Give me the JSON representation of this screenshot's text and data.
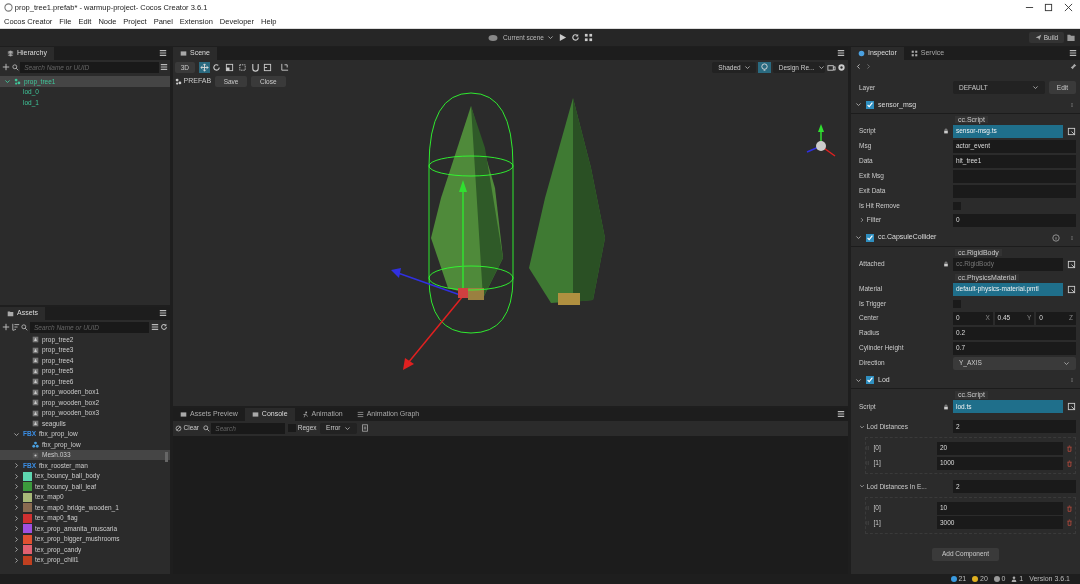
{
  "window": {
    "title": "prop_tree1.prefab* - warmup-project- Cocos Creator 3.6.1"
  },
  "menu": [
    "Cocos Creator",
    "File",
    "Edit",
    "Node",
    "Project",
    "Panel",
    "Extension",
    "Developer",
    "Help"
  ],
  "toolbar": {
    "scene_select": "Current scene",
    "build": "Build"
  },
  "hierarchy": {
    "title": "Hierarchy",
    "placeholder": "Search Name or UUID",
    "tree": [
      {
        "label": "prop_tree1",
        "kind": "prefab",
        "expanded": true,
        "selected": true,
        "children": [
          {
            "label": "lod_0",
            "selected": false
          },
          {
            "label": "lod_1",
            "selected": false
          }
        ]
      }
    ]
  },
  "assets": {
    "title": "Assets",
    "placeholder": "Search Name or UUID",
    "tree": [
      {
        "children": [
          {
            "label": "prop_tree2",
            "kind": "prefab",
            "selected": false
          },
          {
            "label": "prop_tree3",
            "kind": "prefab",
            "selected": false
          },
          {
            "label": "prop_tree4",
            "kind": "prefab",
            "selected": false
          },
          {
            "label": "prop_tree5",
            "kind": "prefab",
            "selected": false
          },
          {
            "label": "prop_tree6",
            "kind": "prefab",
            "selected": false
          },
          {
            "label": "prop_wooden_box1",
            "kind": "prefab",
            "selected": false
          },
          {
            "label": "prop_wooden_box2",
            "kind": "prefab",
            "selected": false
          },
          {
            "label": "prop_wooden_box3",
            "kind": "prefab",
            "selected": false
          },
          {
            "label": "seagulls",
            "kind": "prefab",
            "selected": false
          }
        ]
      },
      {
        "label": "fbx_prop_low",
        "kind": "fbx",
        "badge": "FBX",
        "expanded": true,
        "selected": false,
        "children": [
          {
            "label": "fbx_prop_low",
            "kind": "node",
            "selected": false
          },
          {
            "label": "Mesh.033",
            "kind": "mesh",
            "selected": true
          }
        ]
      },
      {
        "label": "fbx_rooster_man",
        "kind": "fbx",
        "badge": "FBX",
        "expanded": false,
        "selected": false
      },
      {
        "label": "tex_bouncy_ball_body",
        "kind": "texture",
        "color": "#5ed6b0",
        "expanded": false,
        "selected": false
      },
      {
        "label": "tex_bouncy_ball_leaf",
        "kind": "texture",
        "color": "#3c9a3c",
        "expanded": false,
        "selected": false
      },
      {
        "label": "tex_map0",
        "kind": "texture",
        "color": "#a8b878",
        "expanded": false,
        "selected": false
      },
      {
        "label": "tex_map0_bridge_wooden_1",
        "kind": "texture",
        "color": "#8a6a50",
        "expanded": false,
        "selected": false
      },
      {
        "label": "tex_map0_flag",
        "kind": "texture",
        "color": "#d03030",
        "expanded": false,
        "selected": false
      },
      {
        "label": "tex_prop_amanita_muscaria",
        "kind": "texture",
        "color": "#a050e0",
        "expanded": false,
        "selected": false
      },
      {
        "label": "tex_prop_bigger_mushrooms",
        "kind": "texture",
        "color": "#e05030",
        "expanded": false,
        "selected": false
      },
      {
        "label": "tex_prop_candy",
        "kind": "texture",
        "color": "#e06070",
        "expanded": false,
        "selected": false
      },
      {
        "label": "tex_prop_chili1",
        "kind": "texture",
        "color": "#c04020",
        "expanded": false,
        "selected": false
      }
    ]
  },
  "scene": {
    "title": "Scene",
    "mode": "3D",
    "tools": [
      {
        "kind": "move",
        "selected": true
      },
      {
        "kind": "rotate",
        "selected": false
      },
      {
        "kind": "scale",
        "selected": false
      },
      {
        "kind": "rect",
        "selected": false
      },
      {
        "kind": "snap",
        "selected": false
      },
      {
        "kind": "pivot",
        "selected": false
      },
      {
        "kind": "local",
        "selected": false
      }
    ],
    "shading": "Shaded",
    "lighting_on": true,
    "design_resolution": "Design Re...",
    "prefab_label": "PREFAB",
    "prefab_buttons": [
      "Save",
      "Close"
    ]
  },
  "bottom_panel": {
    "tabs": [
      {
        "label": "Assets Preview",
        "selected": false
      },
      {
        "label": "Console",
        "selected": true
      },
      {
        "label": "Animation",
        "selected": false
      },
      {
        "label": "Animation Graph",
        "selected": false
      }
    ],
    "clear": "Clear",
    "search_placeholder": "Search",
    "regex": {
      "label": "Regex",
      "checked": false
    },
    "level": "Error"
  },
  "inspector": {
    "tabs": [
      {
        "label": "Inspector",
        "selected": true
      },
      {
        "label": "Service",
        "selected": false
      }
    ],
    "layer": {
      "label": "Layer",
      "value": "DEFAULT",
      "button": "Edit"
    },
    "components": [
      {
        "name": "sensor_msg",
        "enabled": true,
        "expanded": true,
        "help": false,
        "props": [
          {
            "kind": "asset",
            "label": "Script",
            "tag": "cc.Script",
            "value": "sensor-msg.ts",
            "locked": true,
            "assigned": true
          },
          {
            "kind": "text",
            "label": "Msg",
            "value": "actor_event"
          },
          {
            "kind": "text",
            "label": "Data",
            "value": "hit_tree1"
          },
          {
            "kind": "text",
            "label": "Exit Msg"
          },
          {
            "kind": "text",
            "label": "Exit Data"
          },
          {
            "kind": "checkbox",
            "label": "Is Hit Remove",
            "checked": false
          },
          {
            "kind": "group",
            "label": "Filter",
            "value": "0",
            "expanded": false
          }
        ]
      },
      {
        "name": "cc.CapsuleCollider",
        "enabled": true,
        "expanded": true,
        "help": true,
        "props": [
          {
            "kind": "asset",
            "label": "Attached",
            "tag": "cc.RigidBody",
            "placeholder": "cc.RigidBody",
            "locked": true,
            "assigned": false
          },
          {
            "kind": "asset",
            "label": "Material",
            "tag": "cc.PhysicsMaterial",
            "value": "default-physics-material.pmtl",
            "locked": false,
            "assigned": true
          },
          {
            "kind": "checkbox",
            "label": "Is Trigger",
            "checked": false
          },
          {
            "kind": "vec3",
            "label": "Center",
            "values": [
              "0",
              "0.45",
              "0"
            ],
            "axes": [
              "X",
              "Y",
              "Z"
            ]
          },
          {
            "kind": "text",
            "label": "Radius",
            "value": "0.2"
          },
          {
            "kind": "text",
            "label": "Cylinder Height",
            "value": "0.7"
          },
          {
            "kind": "select",
            "label": "Direction",
            "value": "Y_AXIS"
          }
        ]
      },
      {
        "name": "Lod",
        "enabled": true,
        "expanded": true,
        "help": false,
        "props": [
          {
            "kind": "asset",
            "label": "Script",
            "tag": "cc.Script",
            "value": "lod.ts",
            "locked": true,
            "assigned": true
          },
          {
            "kind": "array",
            "label": "Lod Distances",
            "value": "2",
            "expanded": true,
            "items": [
              {
                "index": "[0]",
                "value": "20"
              },
              {
                "index": "[1]",
                "value": "1000"
              }
            ]
          },
          {
            "kind": "array",
            "label": "Lod Distances In E...",
            "value": "2",
            "expanded": true,
            "items": [
              {
                "index": "[0]",
                "value": "10"
              },
              {
                "index": "[1]",
                "value": "3000"
              }
            ]
          }
        ]
      }
    ],
    "add_component": "Add Component"
  },
  "status_bar": {
    "info": "21",
    "warnings": "20",
    "errors": "0",
    "users": "1",
    "version": "Version 3.6.1"
  }
}
